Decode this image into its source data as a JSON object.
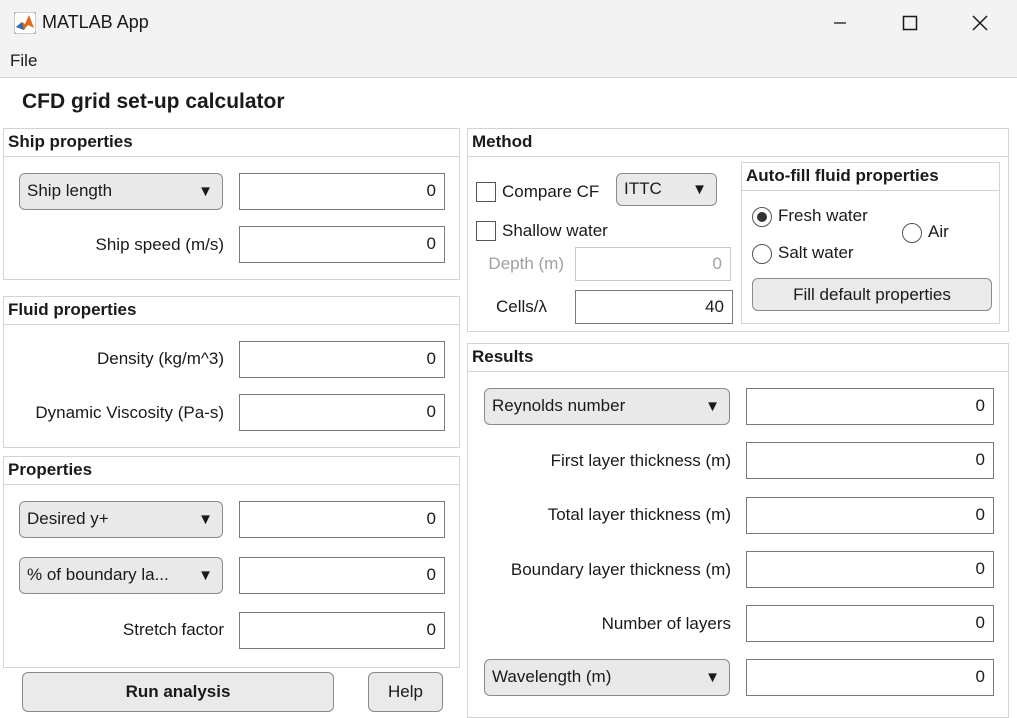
{
  "window": {
    "title": "MATLAB App",
    "minimize_icon": "minimize-icon",
    "maximize_icon": "maximize-icon",
    "close_icon": "close-icon"
  },
  "menu": {
    "file": "File"
  },
  "app_title": "CFD grid set-up calculator",
  "ship": {
    "title": "Ship properties",
    "length_dropdown": "Ship length",
    "length_value": "0",
    "speed_label": "Ship speed (m/s)",
    "speed_value": "0"
  },
  "fluid": {
    "title": "Fluid properties",
    "density_label": "Density (kg/m^3)",
    "density_value": "0",
    "viscosity_label": "Dynamic Viscosity (Pa-s)",
    "viscosity_value": "0"
  },
  "properties": {
    "title": "Properties",
    "yplus_dropdown": "Desired y+",
    "yplus_value": "0",
    "bl_dropdown": "% of boundary la...",
    "bl_value": "0",
    "stretch_label": "Stretch factor",
    "stretch_value": "0"
  },
  "buttons": {
    "run": "Run analysis",
    "help": "Help"
  },
  "method": {
    "title": "Method",
    "compare_cf": "Compare CF",
    "compare_cf_checked": false,
    "cf_dropdown": "ITTC",
    "shallow_water": "Shallow water",
    "shallow_water_checked": false,
    "depth_label": "Depth (m)",
    "depth_value": "0",
    "cells_label": "Cells/λ",
    "cells_value": "40"
  },
  "autofill": {
    "title": "Auto-fill fluid properties",
    "fresh": "Fresh water",
    "salt": "Salt water",
    "air": "Air",
    "selected": "Fresh water",
    "fill_button": "Fill default properties"
  },
  "results": {
    "title": "Results",
    "re_dropdown": "Reynolds number",
    "re_value": "0",
    "first_label": "First layer thickness (m)",
    "first_value": "0",
    "total_label": "Total layer thickness (m)",
    "total_value": "0",
    "bl_label": "Boundary layer thickness (m)",
    "bl_value": "0",
    "layers_label": "Number of layers",
    "layers_value": "0",
    "wave_dropdown": "Wavelength (m)",
    "wave_value": "0"
  },
  "colors": {
    "matlab_orange": "#e06a1b",
    "matlab_blue": "#2f6db3"
  }
}
